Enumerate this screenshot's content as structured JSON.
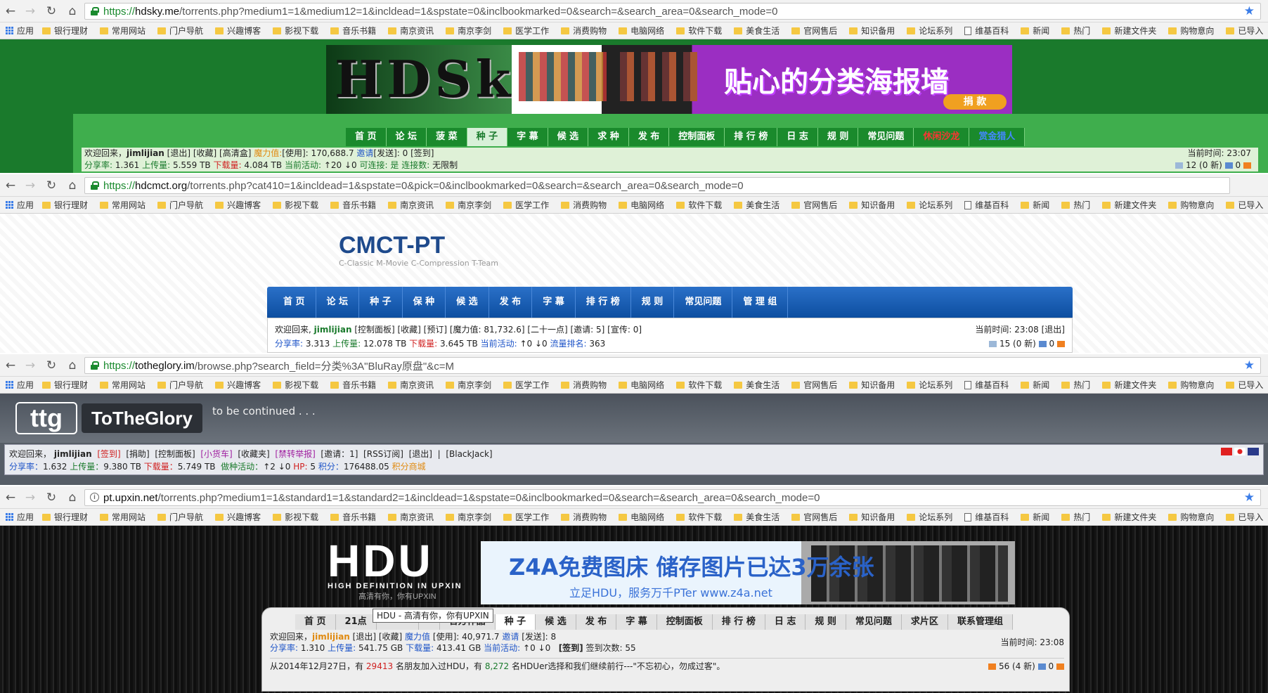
{
  "bookmarks": {
    "apps": "应用",
    "items": [
      "银行理财",
      "常用网站",
      "门户导航",
      "兴趣博客",
      "影视下载",
      "音乐书籍",
      "南京资讯",
      "南京李剑",
      "医学工作",
      "消费购物",
      "电脑网络",
      "软件下载",
      "美食生活",
      "官网售后",
      "知识备用",
      "论坛系列",
      "维基百科",
      "新闻",
      "热门",
      "新建文件夹",
      "购物意向",
      "已导入"
    ]
  },
  "hdsky": {
    "url_scheme": "https://",
    "url_host": "hdsky.me",
    "url_path": "/torrents.php?medium1=1&medium12=1&incldead=1&spstate=0&inclbookmarked=0&search=&search_area=0&search_mode=0",
    "logo": "HDSky",
    "slogan": "贴心的分类海报墙",
    "donate": "捐 款",
    "menu": [
      "首 页",
      "论 坛",
      "菠 菜",
      "种 子",
      "字 幕",
      "候 选",
      "求 种",
      "发 布",
      "控制面板",
      "排 行 榜",
      "日 志",
      "规 则",
      "常见问题",
      "休闲沙龙",
      "赏金猎人"
    ],
    "line1": {
      "welcome": "欢迎回来，",
      "user": "jimlijian",
      "links": "[退出] [收藏] [高清盒]",
      "magic_label": "魔力值:",
      "magic": "[使用]: 170,688.7",
      "invite_label": "邀请",
      "invite": "[发送]: 0",
      "sign": "[签到]"
    },
    "line2": {
      "ratio_label": "分享率:",
      "ratio": "1.361",
      "up_label": "上传量:",
      "up": "5.559 TB",
      "down_label": "下载量:",
      "down": "4.084 TB",
      "active_label": "当前活动:",
      "active": "↑20 ↓0",
      "conn_label": "可连接:",
      "conn": "是",
      "limit_label": "连接数:",
      "limit": "无限制"
    },
    "time": "当前时间: 23:07",
    "msgs": "12 (0 新)",
    "rss": "0"
  },
  "cmct": {
    "url_scheme": "https://",
    "url_host": "hdcmct.org",
    "url_path": "/torrents.php?cat410=1&incldead=1&spstate=0&pick=0&inclbookmarked=0&search=&search_area=0&search_mode=0",
    "title": "CMCT-PT",
    "subtitle": "C-Classic M-Movie C-Compression T-Team",
    "menu": [
      "首 页",
      "论 坛",
      "种 子",
      "保 种",
      "候 选",
      "发 布",
      "字 幕",
      "排 行 榜",
      "规 则",
      "常见问题",
      "管 理 组"
    ],
    "line1": {
      "welcome": "欢迎回来,",
      "user": "jimlijian",
      "links": "[控制面板] [收藏] [预订] [魔力值: 81,732.6] [二十一点] [邀请: 5] [宣传: 0]"
    },
    "line2": {
      "ratio_label": "分享率:",
      "ratio": "3.313",
      "up_label": "上传量:",
      "up": "12.078 TB",
      "down_label": "下载量:",
      "down": "3.645 TB",
      "active_label": "当前活动:",
      "active": "↑0 ↓0",
      "rank_label": "流量排名:",
      "rank": "363"
    },
    "time": "当前时间: 23:08 [退出]",
    "msgs": "15 (0 新)",
    "rss": "0"
  },
  "ttg": {
    "url_scheme": "https://",
    "url_host": "totheglory.im",
    "url_path": "/browse.php?search_field=分类%3A\"BluRay原盘\"&c=M",
    "logo": "ttg",
    "name": "ToTheGlory",
    "tagline": "to be continued . . .",
    "line1": {
      "welcome": "欢迎回来，",
      "user": "jimlijian",
      "sign": "[签到]",
      "donate": "[捐助]",
      "panel": "[控制面板]",
      "shop": "[小货车]",
      "fav": "[收藏夹]",
      "report": "[禁转举报]",
      "invite": "[邀请：1]",
      "rss": "[RSS订阅]",
      "logout": "[退出]",
      "sep": "|",
      "game": "[BlackJack]"
    },
    "line2": {
      "ratio_label": "分享率：",
      "ratio": "1.632",
      "up_label": "上传量：",
      "up": "9.380 TB",
      "down_label": "下载量：",
      "down": "5.749 TB",
      "seed_label": "做种活动：",
      "seed": "↑2 ↓0",
      "hp_label": "HP:",
      "hp": "5",
      "score_label": "积分：",
      "score": "176488.05",
      "mall": "积分商城"
    }
  },
  "hdu": {
    "url_host": "pt.upxin.net",
    "url_path": "/torrents.php?medium1=1&standard1=1&standard2=1&incldead=1&spstate=0&inclbookmarked=0&search=&search_area=0&search_mode=0",
    "logo": "HDU",
    "logo_sub": "HIGH DEFINITION IN UPXIN",
    "logo_cn": "高清有你，你有UPXIN",
    "ad_title": "Z4A免费图床 储存图片已达3万余张",
    "ad_sub": "立足HDU，服务万千PTer     www.z4a.net",
    "tooltip": "HDU - 高清有你，你有UPXIN",
    "menu": [
      "首 页",
      "21点",
      "",
      "",
      "官方作品",
      "种 子",
      "候 选",
      "发 布",
      "字 幕",
      "控制面板",
      "排 行 榜",
      "日 志",
      "规 则",
      "常见问题",
      "求片区",
      "联系管理组"
    ],
    "line1": {
      "welcome": "欢迎回来，",
      "user": "jimlijian",
      "links": "[退出] [收藏]",
      "magic_label": "魔力值",
      "magic": "[使用]: 40,971.7",
      "invite_label": "邀请",
      "invite": "[发送]: 8"
    },
    "line2": {
      "ratio_label": "分享率:",
      "ratio": "1.310",
      "up_label": "上传量:",
      "up": "541.75 GB",
      "down_label": "下载量:",
      "down": "413.41 GB",
      "active_label": "当前活动:",
      "active": "↑0 ↓0",
      "sign": "[签到]",
      "sign_count": "签到次数: 55"
    },
    "time": "当前时间: 23:08",
    "notice": {
      "p1": "从2014年12月27日，有",
      "count1": "29413",
      "p2": "名朋友加入过HDU，有",
      "count2": "8,272",
      "p3": "名HDUer选择和我们继续前行---\"不忘初心，勿成过客\"。"
    },
    "msgs": "56 (4 新)",
    "rss": "0"
  }
}
